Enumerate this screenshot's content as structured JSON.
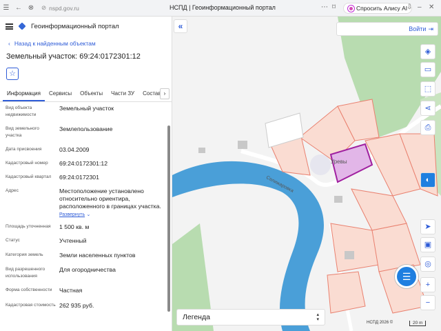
{
  "browser": {
    "url": "nspd.gov.ru",
    "tab_title": "НСПД | Геоинформационный портал",
    "alice_label": "Спросить Алису AI"
  },
  "header": {
    "portal_name": "Геоинформационный портал",
    "back_label": "Назад к найденным объектам",
    "title": "Земельный участок: 69:24:0172301:12"
  },
  "tabs": [
    {
      "label": "Информация"
    },
    {
      "label": "Сервисы"
    },
    {
      "label": "Объекты"
    },
    {
      "label": "Части ЗУ"
    },
    {
      "label": "Состав"
    }
  ],
  "details": [
    {
      "key": "Вид объекта недвижимости",
      "value": "Земельный участок"
    },
    {
      "key": "Вид земельного участка",
      "value": "Землепользование"
    },
    {
      "key": "Дата присвоения",
      "value": "03.04.2009"
    },
    {
      "key": "Кадастровый номер",
      "value": "69:24:0172301:12"
    },
    {
      "key": "Кадастровый квартал",
      "value": "69:24:0172301"
    },
    {
      "key": "Адрес",
      "value": "Местоположение установлено относительно ориентира, расположенного в границах участка.",
      "link": "Развернуть"
    },
    {
      "key": "Площадь уточненная",
      "value": "1 500 кв. м"
    },
    {
      "key": "Статус",
      "value": "Учтенный"
    },
    {
      "key": "Категория земель",
      "value": "Земли населенных пунктов"
    },
    {
      "key": "Вид разрешенного использования",
      "value": "Для огородничества"
    },
    {
      "key": "Форма собственности",
      "value": "Частная"
    },
    {
      "key": "Кадастровая стоимость",
      "value": "262 935 руб."
    }
  ],
  "map": {
    "login_label": "Войти",
    "legend_label": "Легенда",
    "place_label": "Уревы",
    "river_label": "Селижаровка",
    "copyright": "НСПД 2026 ©",
    "scale": "20 m",
    "parcel_color": "#c832c8",
    "river_color": "#4a9fd8",
    "accent": "#2d5bd7"
  }
}
